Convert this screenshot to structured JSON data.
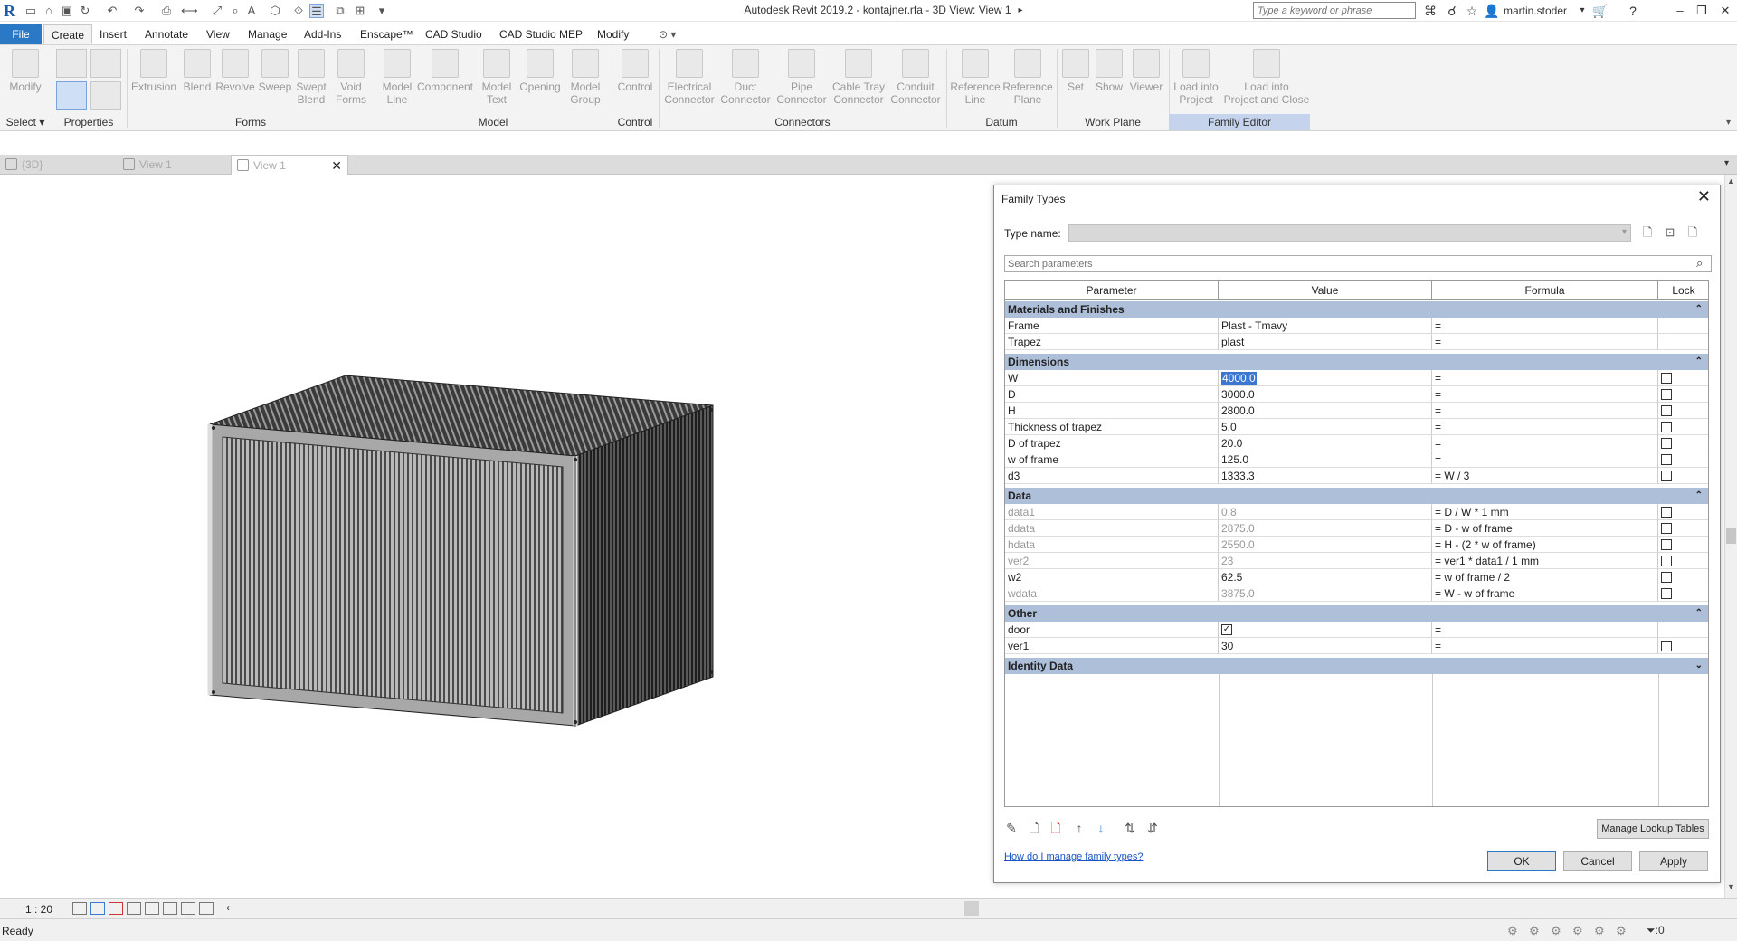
{
  "app": {
    "logo": "R",
    "title": "Autodesk Revit 2019.2 - kontajner.rfa - 3D View: View 1",
    "search_placeholder": "Type a keyword or phrase",
    "user": "martin.stoder"
  },
  "ribbon_tabs": [
    "File",
    "Create",
    "Insert",
    "Annotate",
    "View",
    "Manage",
    "Add-Ins",
    "Enscape™",
    "CAD Studio",
    "CAD Studio MEP",
    "Modify"
  ],
  "ribbon": {
    "modify": "Modify",
    "buttons": {
      "extrusion": "Extrusion",
      "blend": "Blend",
      "revolve": "Revolve",
      "sweep": "Sweep",
      "swept_blend_1": "Swept",
      "swept_blend_2": "Blend",
      "void_1": "Void",
      "void_2": "Forms",
      "model_line_1": "Model",
      "model_line_2": "Line",
      "component": "Component",
      "model_text_1": "Model",
      "model_text_2": "Text",
      "opening": "Opening",
      "model_group_1": "Model",
      "model_group_2": "Group",
      "control": "Control",
      "elec_1": "Electrical",
      "elec_2": "Connector",
      "duct_1": "Duct",
      "duct_2": "Connector",
      "pipe_1": "Pipe",
      "pipe_2": "Connector",
      "cable_1": "Cable Tray",
      "cable_2": "Connector",
      "conduit_1": "Conduit",
      "conduit_2": "Connector",
      "refline_1": "Reference",
      "refline_2": "Line",
      "refplane_1": "Reference",
      "refplane_2": "Plane",
      "set": "Set",
      "show": "Show",
      "viewer": "Viewer",
      "load_1": "Load into",
      "load_2": "Project",
      "loadclose_1": "Load into",
      "loadclose_2": "Project and Close"
    },
    "panels": {
      "select": "Select",
      "properties": "Properties",
      "forms": "Forms",
      "model": "Model",
      "control": "Control",
      "connectors": "Connectors",
      "datum": "Datum",
      "work_plane": "Work Plane",
      "family_editor": "Family Editor"
    }
  },
  "view_tabs": [
    {
      "label": "{3D}"
    },
    {
      "label": "View 1"
    },
    {
      "label": "View 1"
    }
  ],
  "view_bar": {
    "scale": "1 : 20"
  },
  "status": {
    "text": "Ready",
    "filter_count": ":0"
  },
  "dialog": {
    "title": "Family Types",
    "type_name_label": "Type name:",
    "search_placeholder": "Search parameters",
    "columns": [
      "Parameter",
      "Value",
      "Formula",
      "Lock"
    ],
    "groups": [
      {
        "name": "Materials and Finishes",
        "rows": [
          {
            "param": "Frame",
            "value": "Plast - Tmavy",
            "formula": "="
          },
          {
            "param": "Trapez",
            "value": "plast",
            "formula": "="
          }
        ]
      },
      {
        "name": "Dimensions",
        "rows": [
          {
            "param": "W",
            "value": "4000.0",
            "formula": "="
          },
          {
            "param": "D",
            "value": "3000.0",
            "formula": "="
          },
          {
            "param": "H",
            "value": "2800.0",
            "formula": "="
          },
          {
            "param": "Thickness of trapez",
            "value": "5.0",
            "formula": "="
          },
          {
            "param": "D of trapez",
            "value": "20.0",
            "formula": "="
          },
          {
            "param": "w of frame",
            "value": "125.0",
            "formula": "="
          },
          {
            "param": "d3",
            "value": "1333.3",
            "formula": "= W / 3"
          }
        ]
      },
      {
        "name": "Data",
        "rows": [
          {
            "param": "data1",
            "value": "0.8",
            "formula": "= D / W * 1 mm"
          },
          {
            "param": "ddata",
            "value": "2875.0",
            "formula": "= D - w of frame"
          },
          {
            "param": "hdata",
            "value": "2550.0",
            "formula": "= H - (2 * w of frame)"
          },
          {
            "param": "ver2",
            "value": "23",
            "formula": "= ver1 * data1 / 1 mm"
          },
          {
            "param": "w2",
            "value": "62.5",
            "formula": "= w of frame / 2"
          },
          {
            "param": "wdata",
            "value": "3875.0",
            "formula": "= W - w of frame"
          }
        ]
      },
      {
        "name": "Other",
        "rows": [
          {
            "param": "door",
            "value": "",
            "formula": "="
          },
          {
            "param": "ver1",
            "value": "30",
            "formula": "="
          }
        ]
      },
      {
        "name": "Identity Data",
        "rows": []
      }
    ],
    "manage_lookup": "Manage Lookup Tables",
    "help_link": "How do I manage family types?",
    "ok": "OK",
    "cancel": "Cancel",
    "apply": "Apply"
  }
}
